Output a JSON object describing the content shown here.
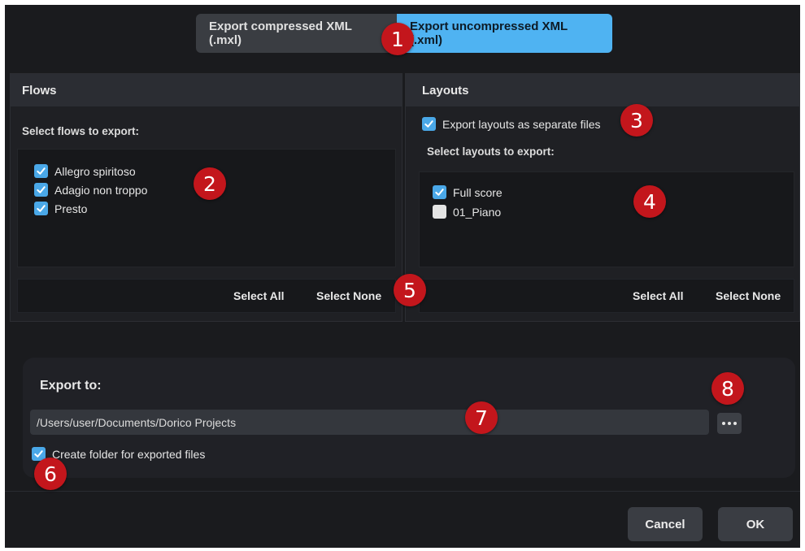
{
  "tabs": [
    {
      "label": "Export compressed XML (.mxl)",
      "active": false
    },
    {
      "label": "Export uncompressed XML (.xml)",
      "active": true
    }
  ],
  "flows": {
    "title": "Flows",
    "select_label": "Select flows to export:",
    "items": [
      {
        "label": "Allegro spiritoso",
        "checked": true
      },
      {
        "label": "Adagio non troppo",
        "checked": true
      },
      {
        "label": "Presto",
        "checked": true
      }
    ],
    "select_all": "Select All",
    "select_none": "Select None"
  },
  "layouts": {
    "title": "Layouts",
    "separate_files_label": "Export layouts as separate files",
    "separate_files_checked": true,
    "select_label": "Select layouts to export:",
    "items": [
      {
        "label": "Full score",
        "checked": true
      },
      {
        "label": "01_Piano",
        "checked": false
      }
    ],
    "select_all": "Select All",
    "select_none": "Select None"
  },
  "export": {
    "label": "Export to:",
    "path": "/Users/user/Documents/Dorico Projects",
    "browse_icon": "ellipsis-icon",
    "create_folder_label": "Create folder for exported files",
    "create_folder_checked": true
  },
  "footer": {
    "cancel": "Cancel",
    "ok": "OK"
  },
  "markers": [
    "1",
    "2",
    "3",
    "4",
    "5",
    "6",
    "7",
    "8"
  ],
  "colors": {
    "accent": "#4fb3f2",
    "checkbox": "#4aa8e8",
    "marker": "#c3161c",
    "background": "#1a1b1e"
  }
}
